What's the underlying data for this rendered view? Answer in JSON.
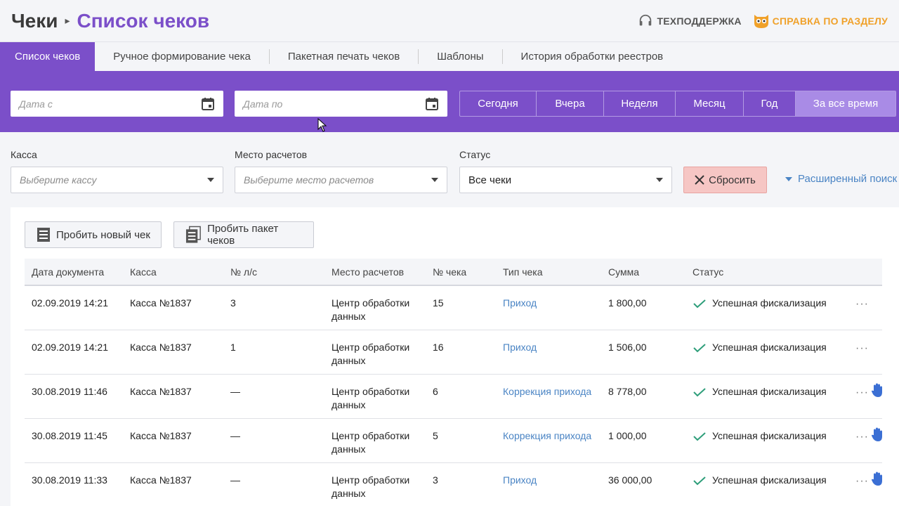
{
  "header": {
    "breadcrumb_root": "Чеки",
    "breadcrumb_current": "Список чеков",
    "support_label": "ТЕХПОДДЕРЖКА",
    "help_label": "СПРАВКА ПО РАЗДЕЛУ"
  },
  "tabs": [
    {
      "label": "Список чеков",
      "active": true
    },
    {
      "label": "Ручное формирование чека"
    },
    {
      "label": "Пакетная печать чеков"
    },
    {
      "label": "Шаблоны"
    },
    {
      "label": "История обработки реестров"
    }
  ],
  "filters": {
    "date_from_placeholder": "Дата с",
    "date_to_placeholder": "Дата по",
    "periods": [
      "Сегодня",
      "Вчера",
      "Неделя",
      "Месяц",
      "Год",
      "За все время"
    ],
    "active_period": "За все время",
    "kassa_label": "Касса",
    "kassa_placeholder": "Выберите кассу",
    "place_label": "Место расчетов",
    "place_placeholder": "Выберите место расчетов",
    "status_label": "Статус",
    "status_value": "Все чеки",
    "reset_label": "Сбросить",
    "advanced_label": "Расширенный поиск"
  },
  "actions": {
    "new_check": "Пробить новый чек",
    "batch_check": "Пробить пакет чеков"
  },
  "table": {
    "columns": [
      "Дата документа",
      "Касса",
      "№ л/с",
      "Место расчетов",
      "№ чека",
      "Тип чека",
      "Сумма",
      "Статус"
    ],
    "rows": [
      {
        "date": "02.09.2019 14:21",
        "kassa": "Касса №1837",
        "account": "3",
        "place1": "Центр обработки",
        "place2": "данных",
        "num": "15",
        "type": "Приход",
        "sum": "1 800,00",
        "status": "Успешная фискализация",
        "hand": false
      },
      {
        "date": "02.09.2019 14:21",
        "kassa": "Касса №1837",
        "account": "1",
        "place1": "Центр обработки",
        "place2": "данных",
        "num": "16",
        "type": "Приход",
        "sum": "1 506,00",
        "status": "Успешная фискализация",
        "hand": false
      },
      {
        "date": "30.08.2019 11:46",
        "kassa": "Касса №1837",
        "account": "—",
        "place1": "Центр обработки",
        "place2": "данных",
        "num": "6",
        "type": "Коррекция прихода",
        "sum": "8 778,00",
        "status": "Успешная фискализация",
        "hand": true
      },
      {
        "date": "30.08.2019 11:45",
        "kassa": "Касса №1837",
        "account": "—",
        "place1": "Центр обработки",
        "place2": "данных",
        "num": "5",
        "type": "Коррекция прихода",
        "sum": "1 000,00",
        "status": "Успешная фискализация",
        "hand": true
      },
      {
        "date": "30.08.2019 11:33",
        "kassa": "Касса №1837",
        "account": "—",
        "place1": "Центр обработки",
        "place2": "данных",
        "num": "3",
        "type": "Приход",
        "sum": "36 000,00",
        "status": "Успешная фискализация",
        "hand": true
      }
    ],
    "more_label": "···"
  },
  "colors": {
    "accent": "#7b4fc9",
    "link": "#4a84c4",
    "help": "#f0a12a",
    "success": "#2e9e7a"
  }
}
